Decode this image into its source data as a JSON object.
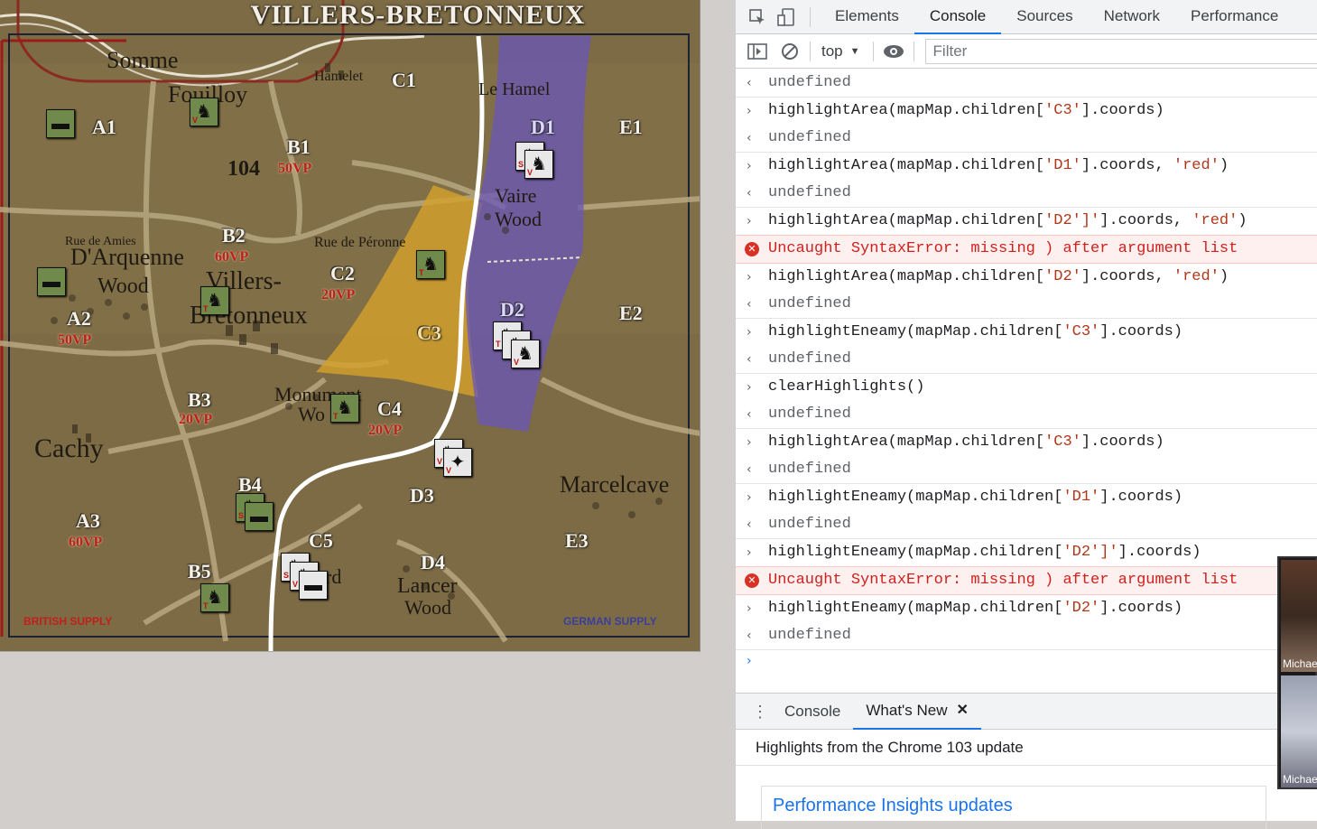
{
  "map": {
    "title": "VILLERS-BRETONNEUX",
    "places": {
      "somme": "Somme",
      "fouilloy": "Fouilloy",
      "hamelet": "Hamelet",
      "le_hamel": "Le Hamel",
      "vaire": "Vaire",
      "wood": "Wood",
      "rue_amiens": "Rue de Amies",
      "arquenne": "D'Arquenne",
      "arquenne_wood": "Wood",
      "villers": "Villers-",
      "bretonneux": "Bretonneux",
      "rue_peronne": "Rue de Péronne",
      "monument": "Monument",
      "monument_wood": "Wo",
      "cachy": "Cachy",
      "marcelcave": "Marcelcave",
      "lancer": "Lancer",
      "lancer_wood": "Wood",
      "rd": "rd",
      "hill": "104"
    },
    "zones": {
      "a1": "A1",
      "a2": "A2",
      "a3": "A3",
      "b1": "B1",
      "b2": "B2",
      "b3": "B3",
      "b4": "B4",
      "b5": "B5",
      "c1": "C1",
      "c2": "C2",
      "c3": "C3",
      "c4": "C4",
      "c5": "C5",
      "d1": "D1",
      "d2": "D2",
      "d3": "D3",
      "d4": "D4",
      "e1": "E1",
      "e2": "E2",
      "e3": "E3"
    },
    "vps": {
      "b1": "50VP",
      "b2": "60VP",
      "c2": "20VP",
      "a2": "50VP",
      "b3": "20VP",
      "c4": "20VP",
      "a3": "60VP"
    },
    "supply": {
      "british": "BRITISH SUPPLY",
      "german": "GERMAN SUPPLY"
    },
    "colors": {
      "british": "#c0201c",
      "german": "#3a3f9a",
      "c3_highlight": "#d4a12a",
      "d_highlight": "#6a55b8"
    }
  },
  "devtools": {
    "tabs": [
      "Elements",
      "Console",
      "Sources",
      "Network",
      "Performance"
    ],
    "active_tab": "Console",
    "context": "top",
    "filter_placeholder": "Filter",
    "console": {
      "undefined": "undefined",
      "error_msg": "Uncaught SyntaxError: missing ) after argument list",
      "cmd1_a": "highlightArea(mapMap.children[",
      "cmd1_s": "'C3'",
      "cmd1_b": "].coords)",
      "cmd2_a": "highlightArea(mapMap.children[",
      "cmd2_s": "'D1'",
      "cmd2_b": "].coords, ",
      "cmd2_s2": "'red'",
      "cmd2_c": ")",
      "cmd3_a": "highlightArea(mapMap.children[",
      "cmd3_s": "'D2']'",
      "cmd3_b": "].coords, ",
      "cmd3_s2": "'red'",
      "cmd3_c": ")",
      "cmd4_a": "highlightArea(mapMap.children[",
      "cmd4_s": "'D2'",
      "cmd4_b": "].coords, ",
      "cmd4_s2": "'red'",
      "cmd4_c": ")",
      "cmd5_a": "highlightEneamy(mapMap.children[",
      "cmd5_s": "'C3'",
      "cmd5_b": "].coords)",
      "cmd6": "clearHighlights()",
      "cmd7_a": "highlightArea(mapMap.children[",
      "cmd7_s": "'C3'",
      "cmd7_b": "].coords)",
      "cmd8_a": "highlightEneamy(mapMap.children[",
      "cmd8_s": "'D1'",
      "cmd8_b": "].coords)",
      "cmd9_a": "highlightEneamy(mapMap.children[",
      "cmd9_s": "'D2']'",
      "cmd9_b": "].coords)",
      "cmd10_a": "highlightEneamy(mapMap.children[",
      "cmd10_s": "'D2'",
      "cmd10_b": "].coords)"
    },
    "drawer": {
      "tab_console": "Console",
      "tab_whats_new": "What's New",
      "headline": "Highlights from the Chrome 103 update",
      "card_link": "Performance Insights updates"
    }
  },
  "video": {
    "tile1_name": "Michael",
    "tile2_name": "Michael"
  }
}
